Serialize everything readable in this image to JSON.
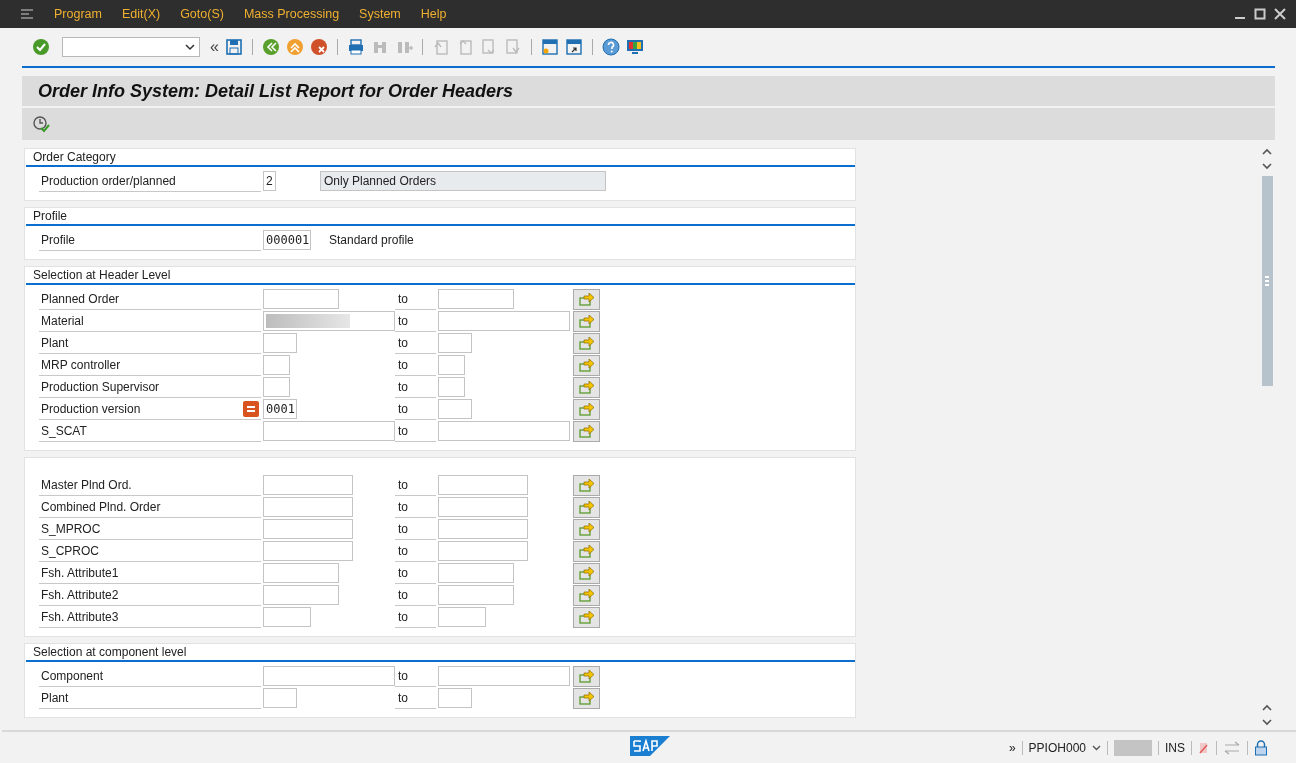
{
  "window": {
    "menu": [
      {
        "label": "Program"
      },
      {
        "label": "Edit(X)"
      },
      {
        "label": "Goto(S)"
      },
      {
        "label": "Mass Processing"
      },
      {
        "label": "System"
      },
      {
        "label": "Help"
      }
    ]
  },
  "toolbar": {
    "collapse": "«"
  },
  "title": "Order Info System: Detail List Report for Order Headers",
  "sections": [
    {
      "title": "Order Category",
      "rows": [
        {
          "kind": "single",
          "label": "Production order/planned",
          "value": "2",
          "description": "Only Planned Orders"
        }
      ]
    },
    {
      "title": "Profile",
      "rows": [
        {
          "kind": "text",
          "label": "Profile",
          "value": "000001",
          "description": "Standard profile"
        }
      ]
    },
    {
      "title": "Selection at Header Level",
      "rows": [
        {
          "kind": "range",
          "label": "Planned Order",
          "to": "to",
          "redacted": false,
          "option_set": false
        },
        {
          "kind": "range",
          "label": "Material",
          "to": "to",
          "redacted": true,
          "option_set": false
        },
        {
          "kind": "range",
          "label": "Plant",
          "to": "to",
          "redacted": false,
          "option_set": false
        },
        {
          "kind": "range",
          "label": "MRP controller",
          "to": "to",
          "redacted": false,
          "option_set": false
        },
        {
          "kind": "range",
          "label": "Production Supervisor",
          "to": "to",
          "redacted": false,
          "option_set": false
        },
        {
          "kind": "range",
          "label": "Production version",
          "value": "0001",
          "to": "to",
          "redacted": false,
          "option_set": true
        },
        {
          "kind": "range",
          "label": "S_SCAT",
          "to": "to",
          "redacted": false,
          "option_set": false
        }
      ]
    },
    {
      "rows": [
        {
          "kind": "range",
          "label": "Master Plnd Ord.",
          "to": "to",
          "redacted": false,
          "option_set": false
        },
        {
          "kind": "range",
          "label": "Combined Plnd. Order",
          "to": "to",
          "redacted": false,
          "option_set": false
        },
        {
          "kind": "range",
          "label": "S_MPROC",
          "to": "to",
          "redacted": false,
          "option_set": false
        },
        {
          "kind": "range",
          "label": "S_CPROC",
          "to": "to",
          "redacted": false,
          "option_set": false
        },
        {
          "kind": "range",
          "label": "Fsh. Attribute1",
          "to": "to",
          "redacted": false,
          "option_set": false
        },
        {
          "kind": "range",
          "label": "Fsh. Attribute2",
          "to": "to",
          "redacted": false,
          "option_set": false
        },
        {
          "kind": "range",
          "label": "Fsh. Attribute3",
          "to": "to",
          "redacted": false,
          "option_set": false
        }
      ]
    },
    {
      "title": "Selection at component level",
      "rows": [
        {
          "kind": "range",
          "label": "Component",
          "to": "to",
          "redacted": false,
          "option_set": false
        },
        {
          "kind": "range",
          "label": "Plant",
          "to": "to",
          "redacted": false,
          "option_set": false
        }
      ]
    }
  ],
  "status_bar": {
    "expand": "»",
    "transaction": "PPIOH000",
    "mode": "INS"
  }
}
